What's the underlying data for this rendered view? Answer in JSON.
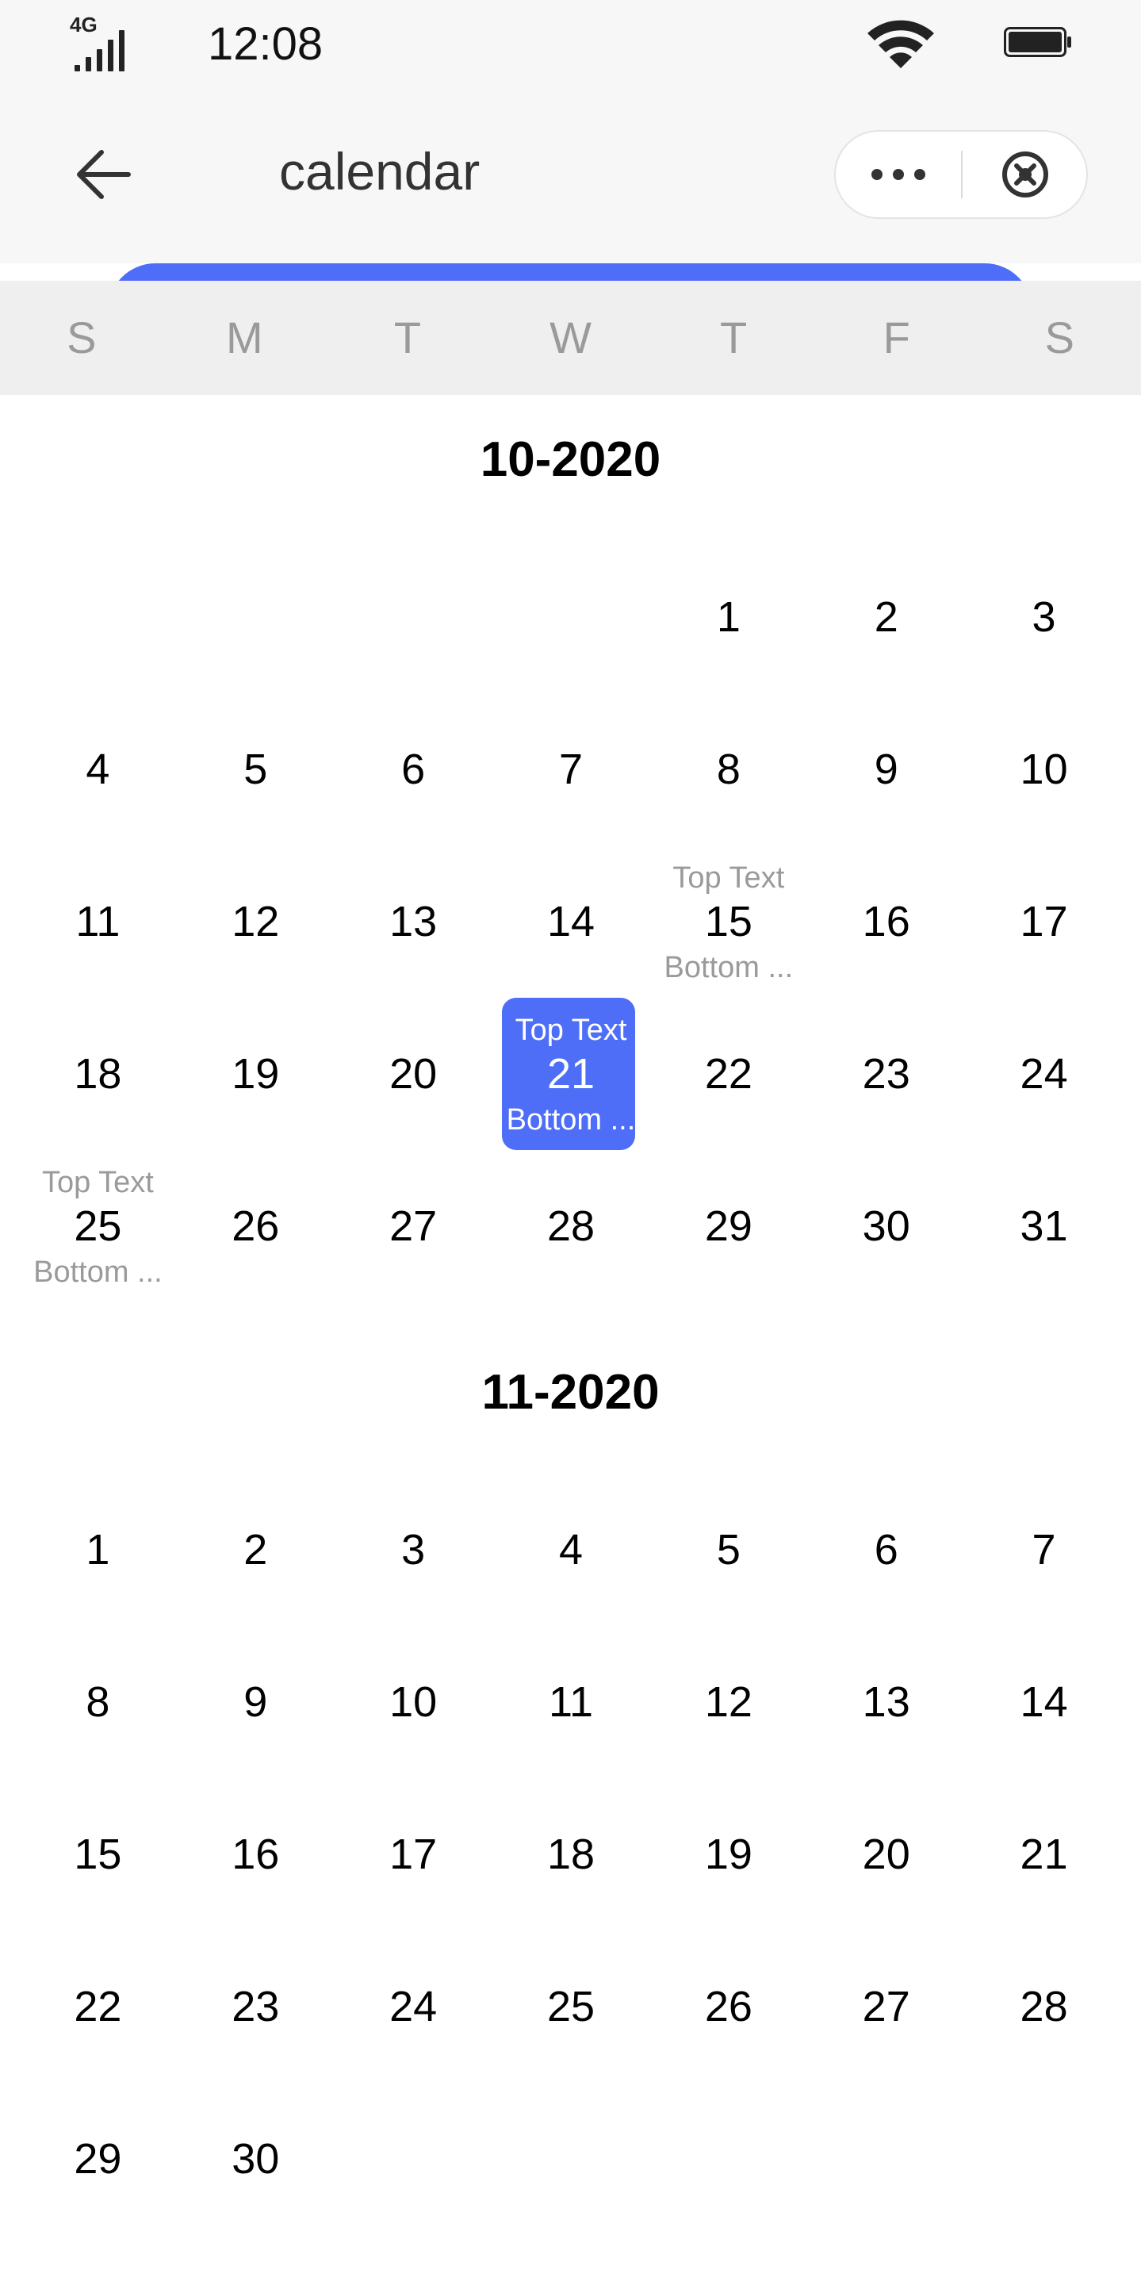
{
  "status_bar": {
    "network": "4G",
    "time": "12:08",
    "icons": [
      "signal-icon",
      "wifi-icon",
      "battery-icon"
    ]
  },
  "nav": {
    "back_icon": "arrow-left-icon",
    "title": "calendar",
    "more_icon": "more-dots-icon",
    "close_icon": "close-circle-icon"
  },
  "week_header": [
    "S",
    "M",
    "T",
    "W",
    "T",
    "F",
    "S"
  ],
  "colors": {
    "accent": "#4f6ef7",
    "muted_text": "#9a9a9a",
    "header_bg": "#efefef",
    "nav_bg": "#f7f7f7"
  },
  "months": [
    {
      "title": "10-2020",
      "leading_blanks": 4,
      "days": [
        {
          "day": "1"
        },
        {
          "day": "2"
        },
        {
          "day": "3"
        },
        {
          "day": "4"
        },
        {
          "day": "5"
        },
        {
          "day": "6"
        },
        {
          "day": "7"
        },
        {
          "day": "8"
        },
        {
          "day": "9"
        },
        {
          "day": "10"
        },
        {
          "day": "11"
        },
        {
          "day": "12"
        },
        {
          "day": "13"
        },
        {
          "day": "14"
        },
        {
          "day": "15",
          "top": "Top Text",
          "bottom": "Bottom ..."
        },
        {
          "day": "16"
        },
        {
          "day": "17"
        },
        {
          "day": "18"
        },
        {
          "day": "19"
        },
        {
          "day": "20"
        },
        {
          "day": "21",
          "top": "Top Text",
          "bottom": "Bottom ...",
          "selected": true
        },
        {
          "day": "22"
        },
        {
          "day": "23"
        },
        {
          "day": "24"
        },
        {
          "day": "25",
          "top": "Top Text",
          "bottom": "Bottom ..."
        },
        {
          "day": "26"
        },
        {
          "day": "27"
        },
        {
          "day": "28"
        },
        {
          "day": "29"
        },
        {
          "day": "30"
        },
        {
          "day": "31"
        }
      ]
    },
    {
      "title": "11-2020",
      "leading_blanks": 0,
      "days": [
        {
          "day": "1"
        },
        {
          "day": "2"
        },
        {
          "day": "3"
        },
        {
          "day": "4"
        },
        {
          "day": "5"
        },
        {
          "day": "6"
        },
        {
          "day": "7"
        },
        {
          "day": "8"
        },
        {
          "day": "9"
        },
        {
          "day": "10"
        },
        {
          "day": "11"
        },
        {
          "day": "12"
        },
        {
          "day": "13"
        },
        {
          "day": "14"
        },
        {
          "day": "15"
        },
        {
          "day": "16"
        },
        {
          "day": "17"
        },
        {
          "day": "18"
        },
        {
          "day": "19"
        },
        {
          "day": "20"
        },
        {
          "day": "21"
        },
        {
          "day": "22"
        },
        {
          "day": "23"
        },
        {
          "day": "24"
        },
        {
          "day": "25"
        },
        {
          "day": "26"
        },
        {
          "day": "27"
        },
        {
          "day": "28"
        },
        {
          "day": "29"
        },
        {
          "day": "30"
        }
      ]
    }
  ]
}
